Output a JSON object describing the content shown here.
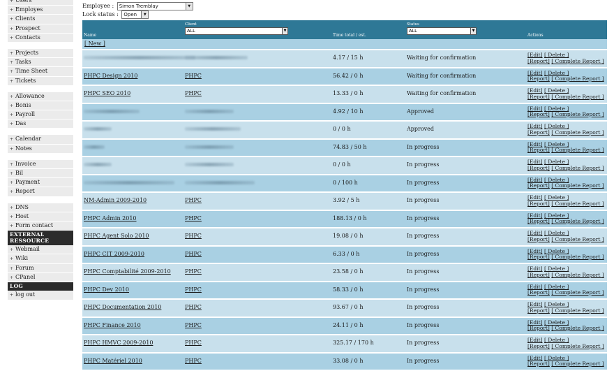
{
  "sidebar": {
    "groups": [
      [
        "Users",
        "Employes",
        "Clients",
        "Prospect",
        "Contacts"
      ],
      [
        "Projects",
        "Tasks",
        "Time Sheet",
        "Tickets"
      ],
      [
        "Allowance",
        "Bonis",
        "Payroll",
        "Das"
      ],
      [
        "Calendar",
        "Notes"
      ],
      [
        "Invoice",
        "Bil",
        "Payment",
        "Report"
      ],
      [
        "DNS",
        "Host",
        "Form contact"
      ]
    ],
    "external_heading": "EXTERNAL RESSOURCE",
    "external": [
      "Webmail",
      "Wiki",
      "Forum",
      "CPanel"
    ],
    "log_heading": "LOG",
    "log": [
      "log out"
    ]
  },
  "filters": {
    "employee_label": "Employee :",
    "employee_value": "Simon Tremblay",
    "lock_label": "Lock status :",
    "lock_value": "Open"
  },
  "table": {
    "headers": {
      "name": "Name",
      "client_filter_label": "Client",
      "client_filter_value": "ALL",
      "time": "Time total / est.",
      "status_filter_label": "Status",
      "status_filter_value": "ALL",
      "actions": "Actions"
    },
    "new_link": "[ New ]",
    "action_labels": {
      "edit": "[Edit]",
      "delete": "[ Delete ]",
      "report": "[Report]",
      "complete_report": "[ Complete Report ]"
    },
    "rows": [
      {
        "name": "",
        "client": "",
        "time": "4.17 / 15 h",
        "status": "Waiting for confirmation",
        "blur_name": 160,
        "blur_client": 90
      },
      {
        "name": "PHPC Design 2010",
        "client": "PHPC",
        "time": "56.42 / 0 h",
        "status": "Waiting for confirmation"
      },
      {
        "name": "PHPC SEO 2010",
        "client": "PHPC",
        "time": "13.33 / 0 h",
        "status": "Waiting for confirmation"
      },
      {
        "name": "",
        "client": "",
        "time": "4.92 / 10 h",
        "status": "Approved",
        "blur_name": 80,
        "blur_client": 70
      },
      {
        "name": "",
        "client": "",
        "time": "0 / 0 h",
        "status": "Approved",
        "blur_name": 40,
        "blur_client": 80
      },
      {
        "name": "",
        "client": "",
        "time": "74.83 / 50 h",
        "status": "In progress",
        "blur_name": 30,
        "blur_client": 70
      },
      {
        "name": "",
        "client": "",
        "time": "0 / 0 h",
        "status": "In progress",
        "blur_name": 40,
        "blur_client": 70
      },
      {
        "name": "",
        "client": "",
        "time": "0 / 100 h",
        "status": "In progress",
        "blur_name": 130,
        "blur_client": 100
      },
      {
        "name": "NM-Admin 2009-2010",
        "client": "PHPC",
        "time": "3.92 / 5 h",
        "status": "In progress"
      },
      {
        "name": "PHPC Admin 2010",
        "client": "PHPC",
        "time": "188.13 / 0 h",
        "status": "In progress"
      },
      {
        "name": "PHPC Agent Solo 2010",
        "client": "PHPC",
        "time": "19.08 / 0 h",
        "status": "In progress"
      },
      {
        "name": "PHPC CIT 2009-2010",
        "client": "PHPC",
        "time": "6.33 / 0 h",
        "status": "In progress"
      },
      {
        "name": "PHPC Comptabilité 2009-2010",
        "client": "PHPC",
        "time": "23.58 / 0 h",
        "status": "In progress"
      },
      {
        "name": "PHPC Dev 2010",
        "client": "PHPC",
        "time": "58.33 / 0 h",
        "status": "In progress"
      },
      {
        "name": "PHPC Documentation 2010",
        "client": "PHPC",
        "time": "93.67 / 0 h",
        "status": "In progress"
      },
      {
        "name": "PHPC Finance 2010",
        "client": "PHPC",
        "time": "24.11 / 0 h",
        "status": "In progress"
      },
      {
        "name": "PHPC HMVC 2009-2010",
        "client": "PHPC",
        "time": "325.17 / 170 h",
        "status": "In progress"
      },
      {
        "name": "PHPC Matériel 2010",
        "client": "PHPC",
        "time": "33.08 / 0 h",
        "status": "In progress"
      }
    ]
  }
}
